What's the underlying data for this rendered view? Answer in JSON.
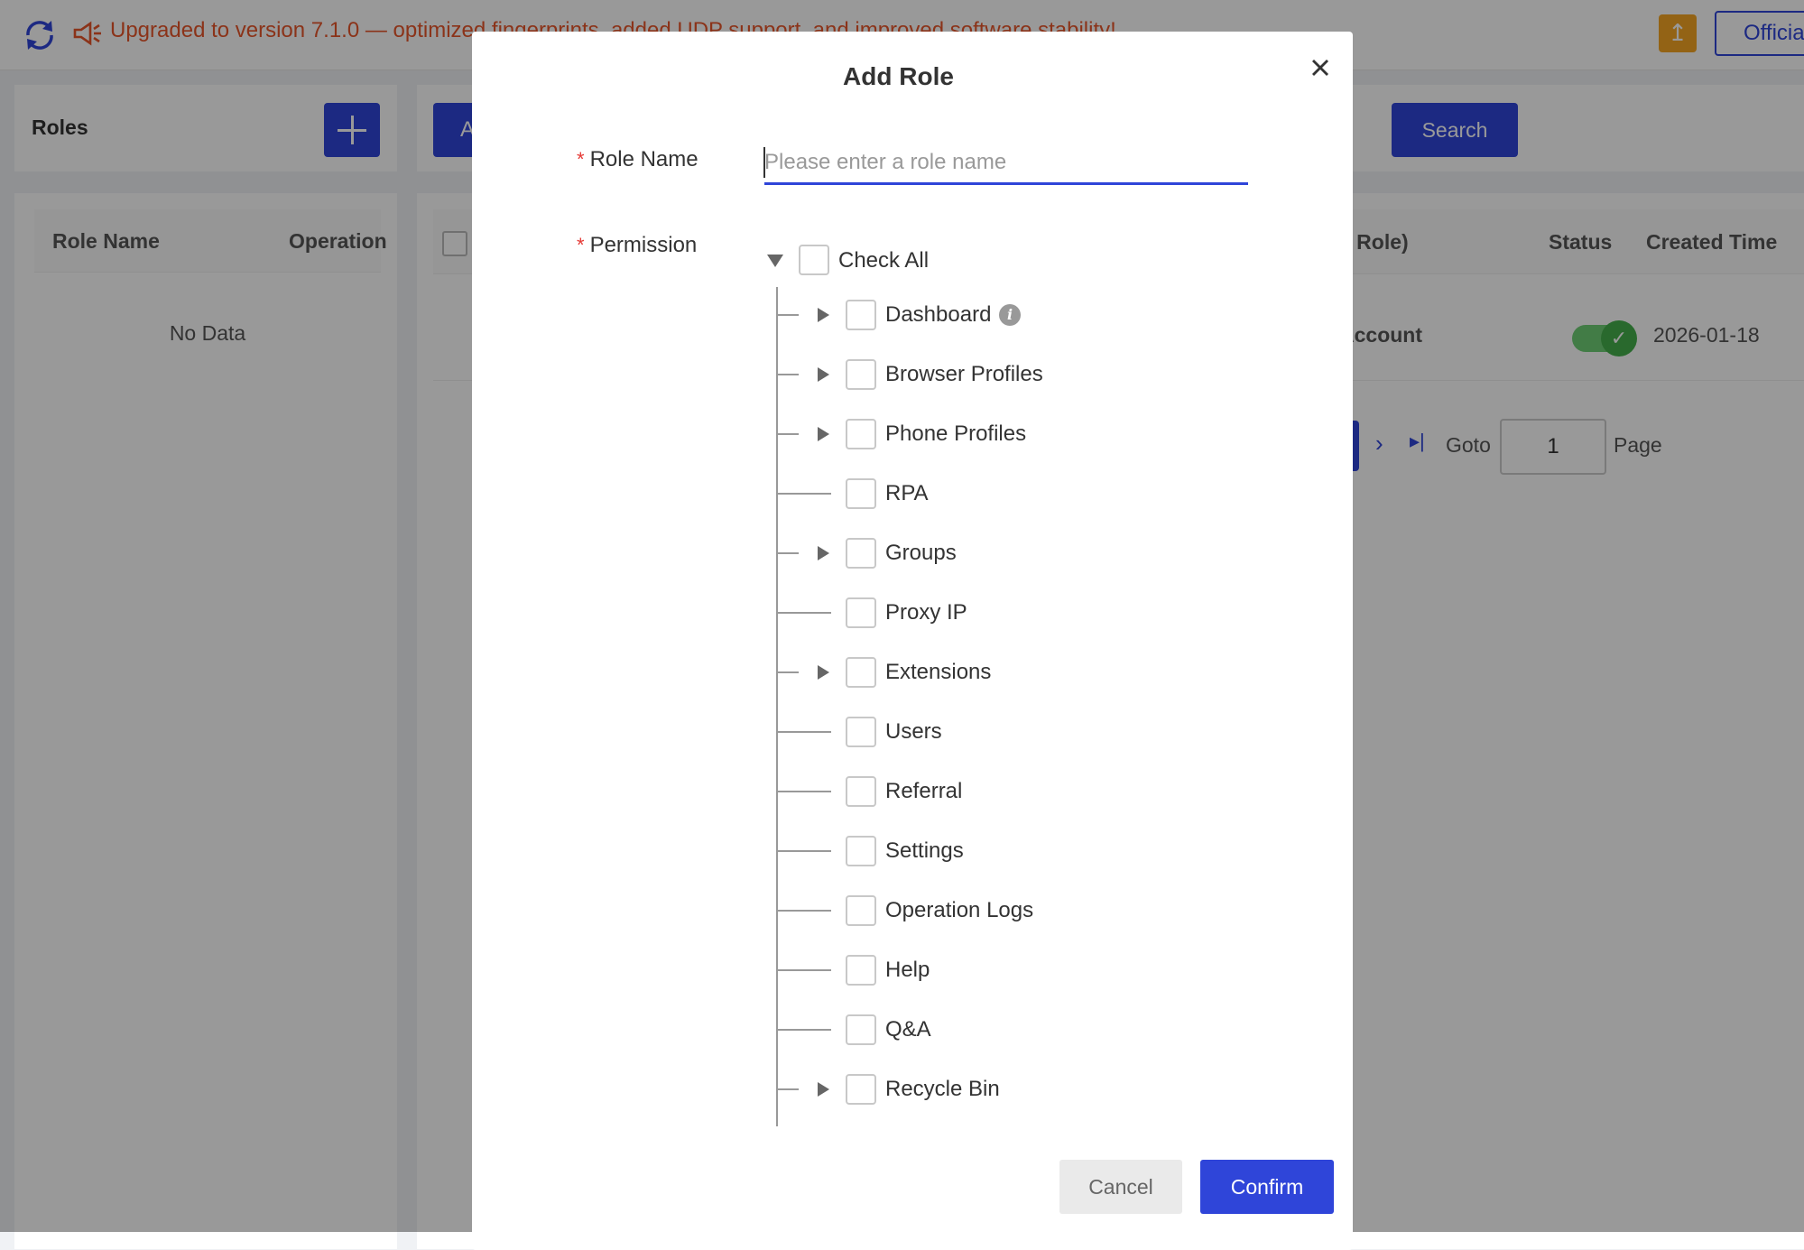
{
  "topbar": {
    "announcement": "Upgraded to version 7.1.0 — optimized fingerprints, added UDP support, and improved software stability!",
    "official_label": "Official",
    "refresh_icon": "refresh-icon",
    "announce_icon": "megaphone-icon",
    "upgrade_icon": "upload-icon"
  },
  "roles_panel": {
    "title": "Roles",
    "columns": [
      "Role Name",
      "Operation"
    ],
    "empty_text": "No Data"
  },
  "main_panel": {
    "add_button_label": "A",
    "search_label": "Search",
    "columns": {
      "role_partial": "a Role)",
      "status": "Status",
      "created_time": "Created Time"
    },
    "row": {
      "role_partial": "Account",
      "status_on": true,
      "created_time": "2026-01-18"
    },
    "pagination": {
      "goto_label": "Goto",
      "goto_value": "1",
      "page_label": "Page"
    }
  },
  "modal": {
    "title": "Add Role",
    "role_name_label": "Role Name",
    "role_name_placeholder": "Please enter a role name",
    "role_name_value": "",
    "permission_label": "Permission",
    "check_all_label": "Check All",
    "items": [
      {
        "label": "Dashboard",
        "expandable": true,
        "info": true
      },
      {
        "label": "Browser Profiles",
        "expandable": true
      },
      {
        "label": "Phone Profiles",
        "expandable": true
      },
      {
        "label": "RPA",
        "expandable": false
      },
      {
        "label": "Groups",
        "expandable": true
      },
      {
        "label": "Proxy IP",
        "expandable": false
      },
      {
        "label": "Extensions",
        "expandable": true
      },
      {
        "label": "Users",
        "expandable": false
      },
      {
        "label": "Referral",
        "expandable": false
      },
      {
        "label": "Settings",
        "expandable": false
      },
      {
        "label": "Operation Logs",
        "expandable": false
      },
      {
        "label": "Help",
        "expandable": false
      },
      {
        "label": "Q&A",
        "expandable": false
      },
      {
        "label": "Recycle Bin",
        "expandable": true
      }
    ],
    "cancel_label": "Cancel",
    "confirm_label": "Confirm"
  },
  "colors": {
    "accent": "#2f45d9",
    "announcement": "#e8562a",
    "required": "#e53935",
    "toggle_on": "#45b04c",
    "upgrade": "#f5a623"
  }
}
